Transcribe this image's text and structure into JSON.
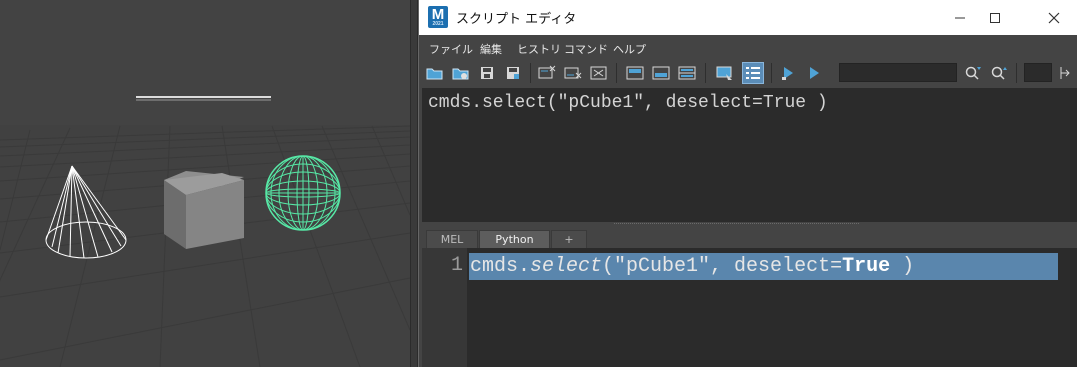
{
  "window": {
    "title": "スクリプト エディタ",
    "app_icon_letter": "M",
    "app_icon_sub": "2021"
  },
  "menu": [
    "ファイル",
    "編集",
    "ヒストリ",
    "コマンド",
    "ヘルプ"
  ],
  "toolbar": {
    "icons": [
      "open-script-icon",
      "source-script-icon",
      "save-script-icon",
      "save-to-shelf-icon",
      "clear-history-icon",
      "clear-input-icon",
      "clear-all-icon",
      "show-history-only-icon",
      "show-input-only-icon",
      "show-both-icon",
      "echo-all-commands-icon",
      "show-line-numbers-icon",
      "execute-selected-icon",
      "execute-all-icon",
      "search-next-icon",
      "search-previous-icon",
      "expand-icon"
    ],
    "active_icon": "show-line-numbers-icon"
  },
  "history": {
    "text": "cmds.select(\"pCube1\", deselect=True )"
  },
  "tabs": [
    {
      "label": "MEL",
      "active": false
    },
    {
      "label": "Python",
      "active": true
    },
    {
      "label": "+",
      "active": false
    }
  ],
  "input": {
    "line_number": "1",
    "code_prefix": "cmds.",
    "code_function": "select",
    "code_args": "(\"pCube1\", deselect=",
    "code_keyword": "True",
    "code_suffix": " )"
  },
  "colors": {
    "accent_highlight": "#5a86ad",
    "sphere_wire": "#57e8a6",
    "viewport_bg": "#444444",
    "editor_pane": "#2b2b2b"
  }
}
